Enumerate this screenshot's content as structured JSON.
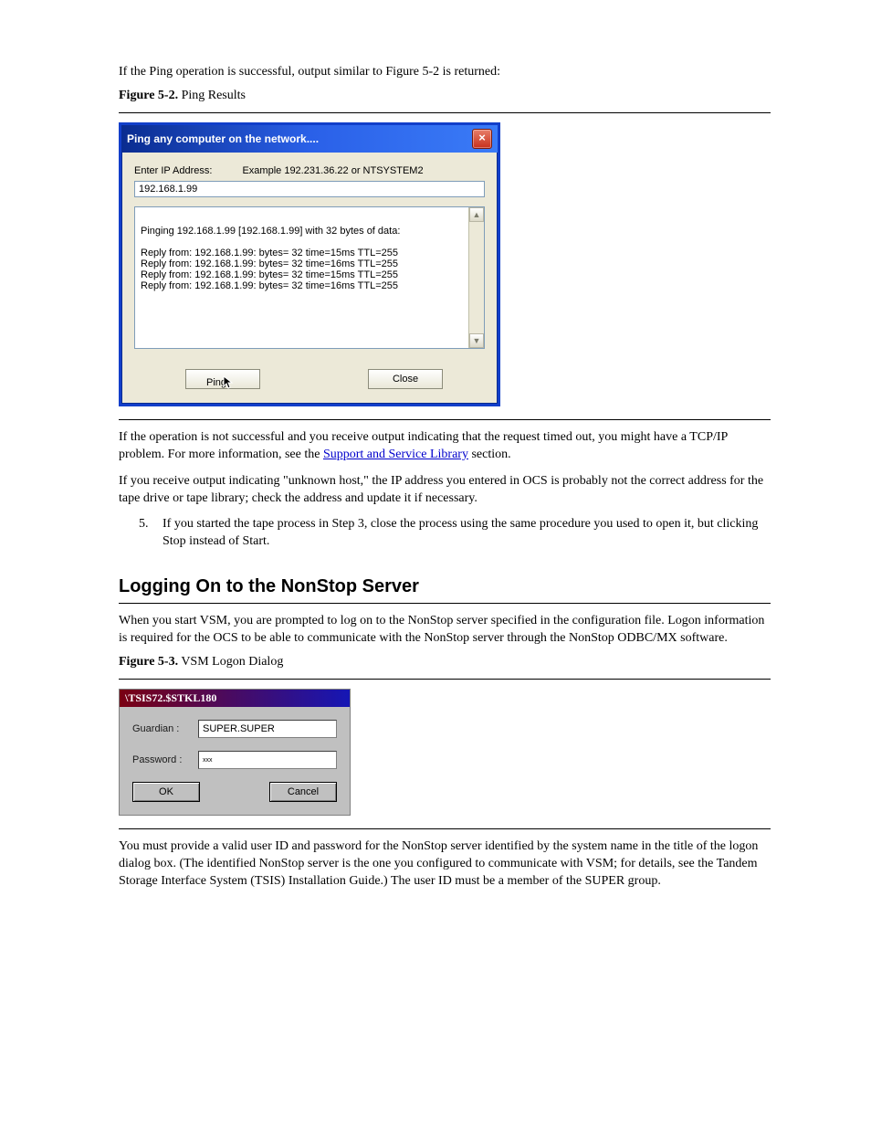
{
  "intro_para": "If the Ping operation is successful, output similar to Figure 5-2 is returned:",
  "fig2_caption_bold": "Figure 5-2.",
  "fig2_caption_text": " Ping Results",
  "ping_dialog": {
    "title": "Ping any computer on the network....",
    "label": "Enter IP Address:",
    "example": "Example 192.231.36.22  or  NTSYSTEM2",
    "ip_value": "192.168.1.99",
    "output_lines": [
      "",
      "Pinging 192.168.1.99 [192.168.1.99] with 32 bytes of data:",
      "",
      "Reply from: 192.168.1.99: bytes= 32 time=15ms TTL=255",
      "Reply from: 192.168.1.99: bytes= 32 time=16ms TTL=255",
      "Reply from: 192.168.1.99: bytes= 32 time=15ms TTL=255",
      "Reply from: 192.168.1.99: bytes= 32 time=16ms TTL=255"
    ],
    "ping_button": "Ping",
    "close_button": "Close"
  },
  "para_after_ping_1": "If the operation is not successful and you receive output indicating that the request timed out, you might have a TCP/IP problem. For more information, see the ",
  "para_link_label": "Support and Service Library",
  "para_after_ping_2": " section.",
  "para_after_ping_3": "If you receive output indicating \"unknown host,\" the IP address you entered in OCS is probably not the correct address for the tape drive or tape library; check the address and update it if necessary.",
  "step5_num": "5.",
  "step5_text": "If you started the tape process in Step 3, close the process using the same procedure you used to open it, but clicking Stop instead of Start.",
  "heading_logon": "Logging On to the NonStop Server",
  "logon_para1": "When you start VSM, you are prompted to log on to the NonStop server specified in the configuration file. Logon information is required for the OCS to be able to communicate with the NonStop server through the NonStop ODBC/MX software.",
  "fig3_caption_bold": "Figure 5-3.",
  "fig3_caption_text": " VSM Logon Dialog",
  "logon_dialog": {
    "title": "\\TSIS72.$STKL180",
    "guardian_label": "Guardian :",
    "guardian_value": "SUPER.SUPER",
    "password_label": "Password :",
    "password_value": "xxx",
    "ok": "OK",
    "cancel": "Cancel"
  },
  "logon_para2": "You must provide a valid user ID and password for the NonStop server identified by the system name in the title of the logon dialog box. (The identified NonStop server is the one you configured to communicate with VSM; for details, see the Tandem Storage Interface System (TSIS) Installation Guide.) The user ID must be a member of the SUPER group."
}
